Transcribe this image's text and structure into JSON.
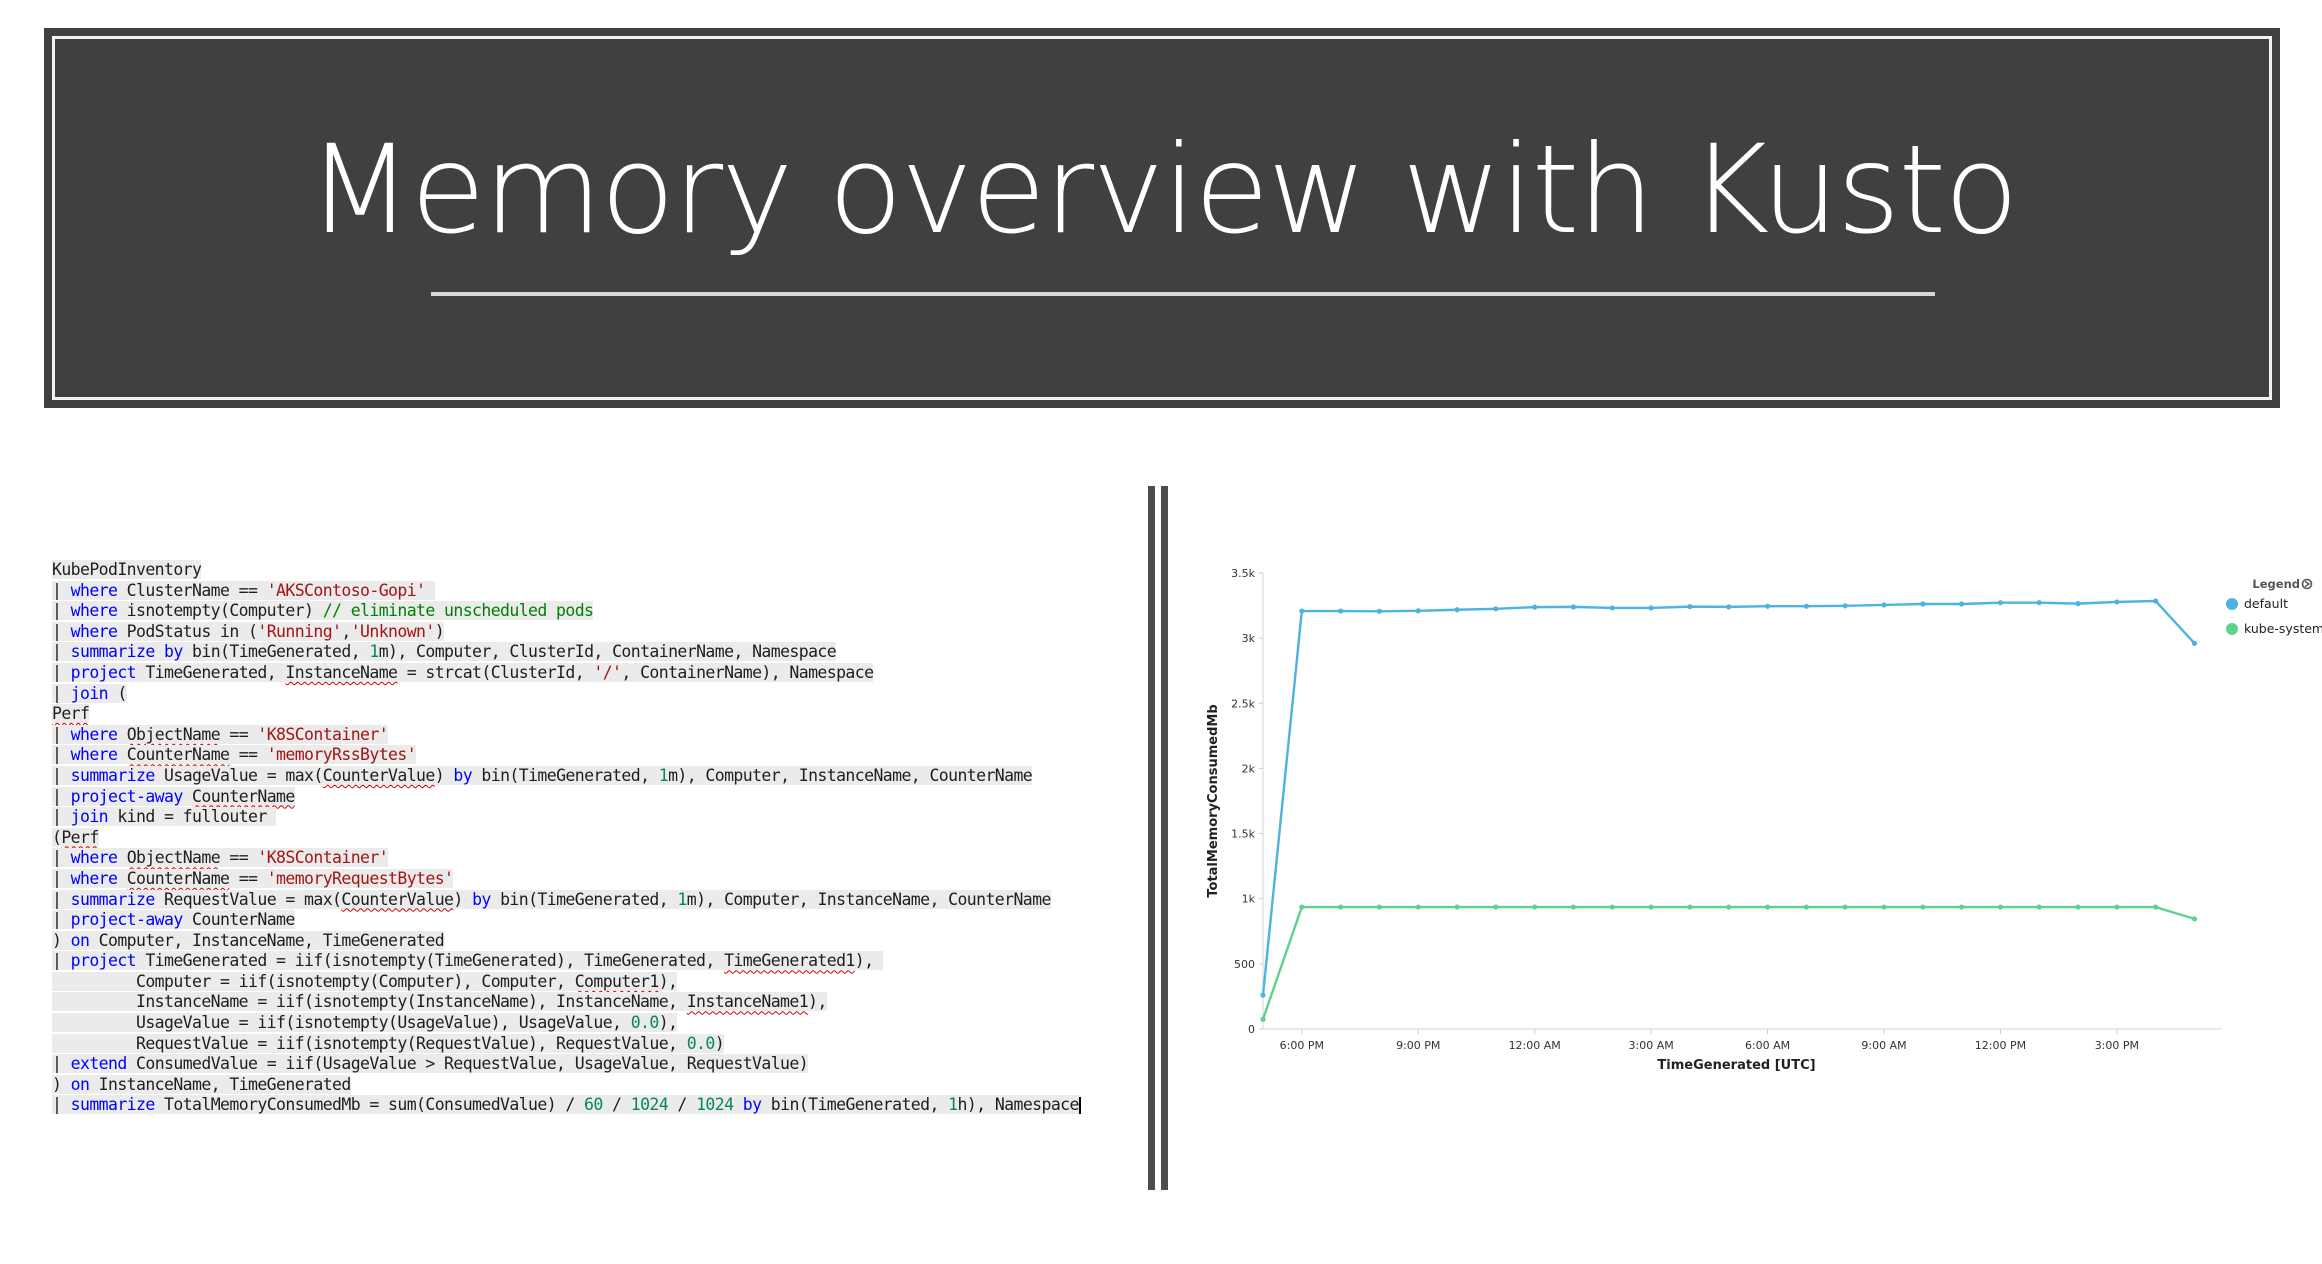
{
  "slide": {
    "title": "Memory overview with Kusto"
  },
  "code": {
    "lines": [
      [
        {
          "t": "KubePodInventory"
        }
      ],
      [
        {
          "t": "| "
        },
        {
          "t": "where",
          "c": "kw"
        },
        {
          "t": " ClusterName == "
        },
        {
          "t": "'AKSContoso-Gopi'",
          "c": "str"
        },
        {
          "t": " "
        }
      ],
      [
        {
          "t": "| "
        },
        {
          "t": "where",
          "c": "kw"
        },
        {
          "t": " isnotempty(Computer) "
        },
        {
          "t": "// eliminate unscheduled pods",
          "c": "cm"
        }
      ],
      [
        {
          "t": "| "
        },
        {
          "t": "where",
          "c": "kw"
        },
        {
          "t": " PodStatus in ("
        },
        {
          "t": "'Running'",
          "c": "str"
        },
        {
          "t": ","
        },
        {
          "t": "'Unknown'",
          "c": "str"
        },
        {
          "t": ")"
        }
      ],
      [
        {
          "t": "| "
        },
        {
          "t": "summarize by",
          "c": "kw"
        },
        {
          "t": " bin(TimeGenerated, "
        },
        {
          "t": "1",
          "c": "num"
        },
        {
          "t": "m), Computer, ClusterId, ContainerName, Namespace"
        }
      ],
      [
        {
          "t": "| "
        },
        {
          "t": "project",
          "c": "kw"
        },
        {
          "t": " TimeGenerated, "
        },
        {
          "t": "InstanceName",
          "c": "squig"
        },
        {
          "t": " = strcat(ClusterId, "
        },
        {
          "t": "'/'",
          "c": "str"
        },
        {
          "t": ", ContainerName), Namespace"
        }
      ],
      [
        {
          "t": "| "
        },
        {
          "t": "join",
          "c": "kw"
        },
        {
          "t": " ("
        }
      ],
      [
        {
          "t": "Perf",
          "c": "squig"
        }
      ],
      [
        {
          "t": "| "
        },
        {
          "t": "where",
          "c": "kw"
        },
        {
          "t": " "
        },
        {
          "t": "ObjectName",
          "c": "squig"
        },
        {
          "t": " == "
        },
        {
          "t": "'K8SContainer'",
          "c": "str"
        }
      ],
      [
        {
          "t": "| "
        },
        {
          "t": "where",
          "c": "kw"
        },
        {
          "t": " "
        },
        {
          "t": "CounterName",
          "c": "squig"
        },
        {
          "t": " == "
        },
        {
          "t": "'memoryRssBytes'",
          "c": "str"
        }
      ],
      [
        {
          "t": "| "
        },
        {
          "t": "summarize",
          "c": "kw"
        },
        {
          "t": " UsageValue = max("
        },
        {
          "t": "CounterValue",
          "c": "squig"
        },
        {
          "t": ") "
        },
        {
          "t": "by",
          "c": "kw"
        },
        {
          "t": " bin(TimeGenerated, "
        },
        {
          "t": "1",
          "c": "num"
        },
        {
          "t": "m), Computer, InstanceName, CounterName"
        }
      ],
      [
        {
          "t": "| "
        },
        {
          "t": "project-away",
          "c": "kw"
        },
        {
          "t": " "
        },
        {
          "t": "CounterName",
          "c": "squig"
        }
      ],
      [
        {
          "t": "| "
        },
        {
          "t": "join",
          "c": "kw"
        },
        {
          "t": " kind = fullouter "
        }
      ],
      [
        {
          "t": "("
        },
        {
          "t": "Perf",
          "c": "squig"
        }
      ],
      [
        {
          "t": "| "
        },
        {
          "t": "where",
          "c": "kw"
        },
        {
          "t": " "
        },
        {
          "t": "ObjectName",
          "c": "squig"
        },
        {
          "t": " == "
        },
        {
          "t": "'K8SContainer'",
          "c": "str"
        }
      ],
      [
        {
          "t": "| "
        },
        {
          "t": "where",
          "c": "kw"
        },
        {
          "t": " "
        },
        {
          "t": "CounterName",
          "c": "squig"
        },
        {
          "t": " == "
        },
        {
          "t": "'memoryRequestBytes'",
          "c": "str"
        }
      ],
      [
        {
          "t": "| "
        },
        {
          "t": "summarize",
          "c": "kw"
        },
        {
          "t": " RequestValue = max("
        },
        {
          "t": "CounterValue",
          "c": "squig"
        },
        {
          "t": ") "
        },
        {
          "t": "by",
          "c": "kw"
        },
        {
          "t": " bin(TimeGenerated, "
        },
        {
          "t": "1",
          "c": "num"
        },
        {
          "t": "m), Computer, InstanceName, CounterName"
        }
      ],
      [
        {
          "t": "| "
        },
        {
          "t": "project-away",
          "c": "kw"
        },
        {
          "t": " CounterName"
        }
      ],
      [
        {
          "t": ") "
        },
        {
          "t": "on",
          "c": "kw"
        },
        {
          "t": " Computer, InstanceName, TimeGenerated"
        }
      ],
      [
        {
          "t": "| "
        },
        {
          "t": "project",
          "c": "kw"
        },
        {
          "t": " TimeGenerated = iif(isnotempty(TimeGenerated), TimeGenerated, "
        },
        {
          "t": "TimeGenerated1",
          "c": "squig"
        },
        {
          "t": "), "
        }
      ],
      [
        {
          "t": "         Computer = iif(isnotempty(Computer), Computer, "
        },
        {
          "t": "Computer1",
          "c": "squig"
        },
        {
          "t": "),"
        }
      ],
      [
        {
          "t": "         InstanceName = iif(isnotempty(InstanceName), InstanceName, "
        },
        {
          "t": "InstanceName1",
          "c": "squig"
        },
        {
          "t": "),"
        }
      ],
      [
        {
          "t": "         UsageValue = iif(isnotempty(UsageValue), UsageValue, "
        },
        {
          "t": "0.0",
          "c": "num"
        },
        {
          "t": "),"
        }
      ],
      [
        {
          "t": "         RequestValue = iif(isnotempty(RequestValue), RequestValue, "
        },
        {
          "t": "0.0",
          "c": "num"
        },
        {
          "t": ")"
        }
      ],
      [
        {
          "t": "| "
        },
        {
          "t": "extend",
          "c": "kw"
        },
        {
          "t": " ConsumedValue = iif(UsageValue > RequestValue, UsageValue, RequestValue)"
        }
      ],
      [
        {
          "t": ") "
        },
        {
          "t": "on",
          "c": "kw"
        },
        {
          "t": " InstanceName, TimeGenerated"
        }
      ],
      [
        {
          "t": "| "
        },
        {
          "t": "summarize",
          "c": "kw"
        },
        {
          "t": " TotalMemoryConsumedMb = sum(ConsumedValue) / "
        },
        {
          "t": "60",
          "c": "num"
        },
        {
          "t": " / "
        },
        {
          "t": "1024",
          "c": "num"
        },
        {
          "t": " / "
        },
        {
          "t": "1024",
          "c": "num"
        },
        {
          "t": " "
        },
        {
          "t": "by",
          "c": "kw"
        },
        {
          "t": " bin(TimeGenerated, "
        },
        {
          "t": "1",
          "c": "num"
        },
        {
          "t": "h), Namespace"
        }
      ]
    ]
  },
  "colors": {
    "title_bg": "#404040",
    "series_default": "#4eb3de",
    "series_kube_system": "#5fd18f",
    "keyword": "#0000ff",
    "string": "#a31515",
    "comment": "#008000",
    "number": "#098658"
  },
  "chart_data": {
    "type": "line",
    "title": "",
    "xlabel": "TimeGenerated [UTC]",
    "ylabel": "TotalMemoryConsumedMb",
    "ylim": [
      0,
      3500
    ],
    "y_ticks": [
      0,
      500,
      1000,
      1500,
      2000,
      2500,
      3000,
      3500
    ],
    "y_tick_labels": [
      "0",
      "500",
      "1k",
      "1.5k",
      "2k",
      "2.5k",
      "3k",
      "3.5k"
    ],
    "x_unit": "hours offset from 6:00 PM",
    "x_ticks": [
      0,
      3,
      6,
      9,
      12,
      15,
      18,
      21
    ],
    "x_tick_labels": [
      "6:00 PM",
      "9:00 PM",
      "12:00 AM",
      "3:00 AM",
      "6:00 AM",
      "9:00 AM",
      "12:00 PM",
      "3:00 PM"
    ],
    "xlim": [
      -1,
      23.4
    ],
    "x": [
      -1,
      0,
      1,
      2,
      3,
      4,
      5,
      6,
      7,
      8,
      9,
      10,
      11,
      12,
      13,
      14,
      15,
      16,
      17,
      18,
      19,
      20,
      21,
      22,
      23
    ],
    "series": [
      {
        "name": "default",
        "values": [
          260,
          3208,
          3208,
          3206,
          3210,
          3218,
          3225,
          3238,
          3240,
          3232,
          3232,
          3242,
          3240,
          3245,
          3245,
          3248,
          3255,
          3262,
          3262,
          3272,
          3272,
          3265,
          3278,
          3285,
          2960
        ]
      },
      {
        "name": "kube-system",
        "values": [
          75,
          936,
          936,
          936,
          936,
          936,
          936,
          936,
          936,
          936,
          936,
          936,
          936,
          936,
          936,
          936,
          936,
          936,
          936,
          936,
          936,
          936,
          936,
          936,
          845
        ]
      }
    ],
    "legend": {
      "title": "Legend",
      "position": "top-right",
      "entries": [
        "default",
        "kube-system"
      ]
    },
    "grid": false
  }
}
